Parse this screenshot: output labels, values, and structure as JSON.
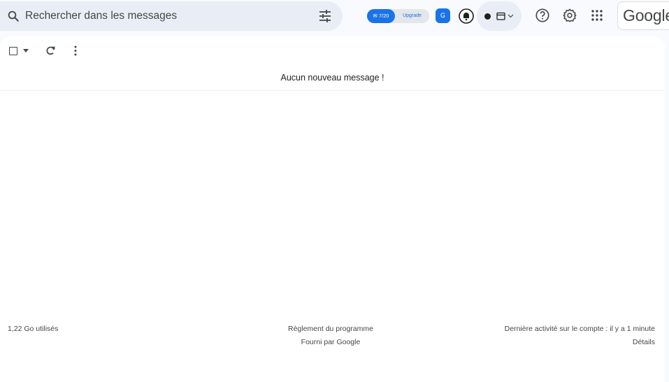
{
  "search": {
    "placeholder": "Rechercher dans les messages",
    "value": "",
    "icon": "search-icon",
    "options_icon": "tune-icon"
  },
  "extension": {
    "count": "✉ 7/20",
    "upgrade": "Upgrade",
    "square_label": "G"
  },
  "status": {
    "icon": "calendar-icon"
  },
  "header_icons": [
    "help-icon",
    "settings-icon",
    "apps-icon"
  ],
  "account": {
    "logo": "Google"
  },
  "toolbar": {
    "select_icon": "checkbox-icon",
    "refresh_icon": "refresh-icon",
    "more_icon": "more-vert-icon"
  },
  "inbox": {
    "empty_message": "Aucun nouveau message !"
  },
  "footer": {
    "storage": "1,22 Go utilisés",
    "policy": "Règlement du programme",
    "powered": "Fourni par Google",
    "activity": "Dernière activité sur le compte : il y a 1 minute",
    "details": "Détails"
  },
  "colors": {
    "accent": "#1a73e8",
    "background": "#f8fafd",
    "search_bg": "#e9eef6",
    "panel": "#ffffff"
  }
}
